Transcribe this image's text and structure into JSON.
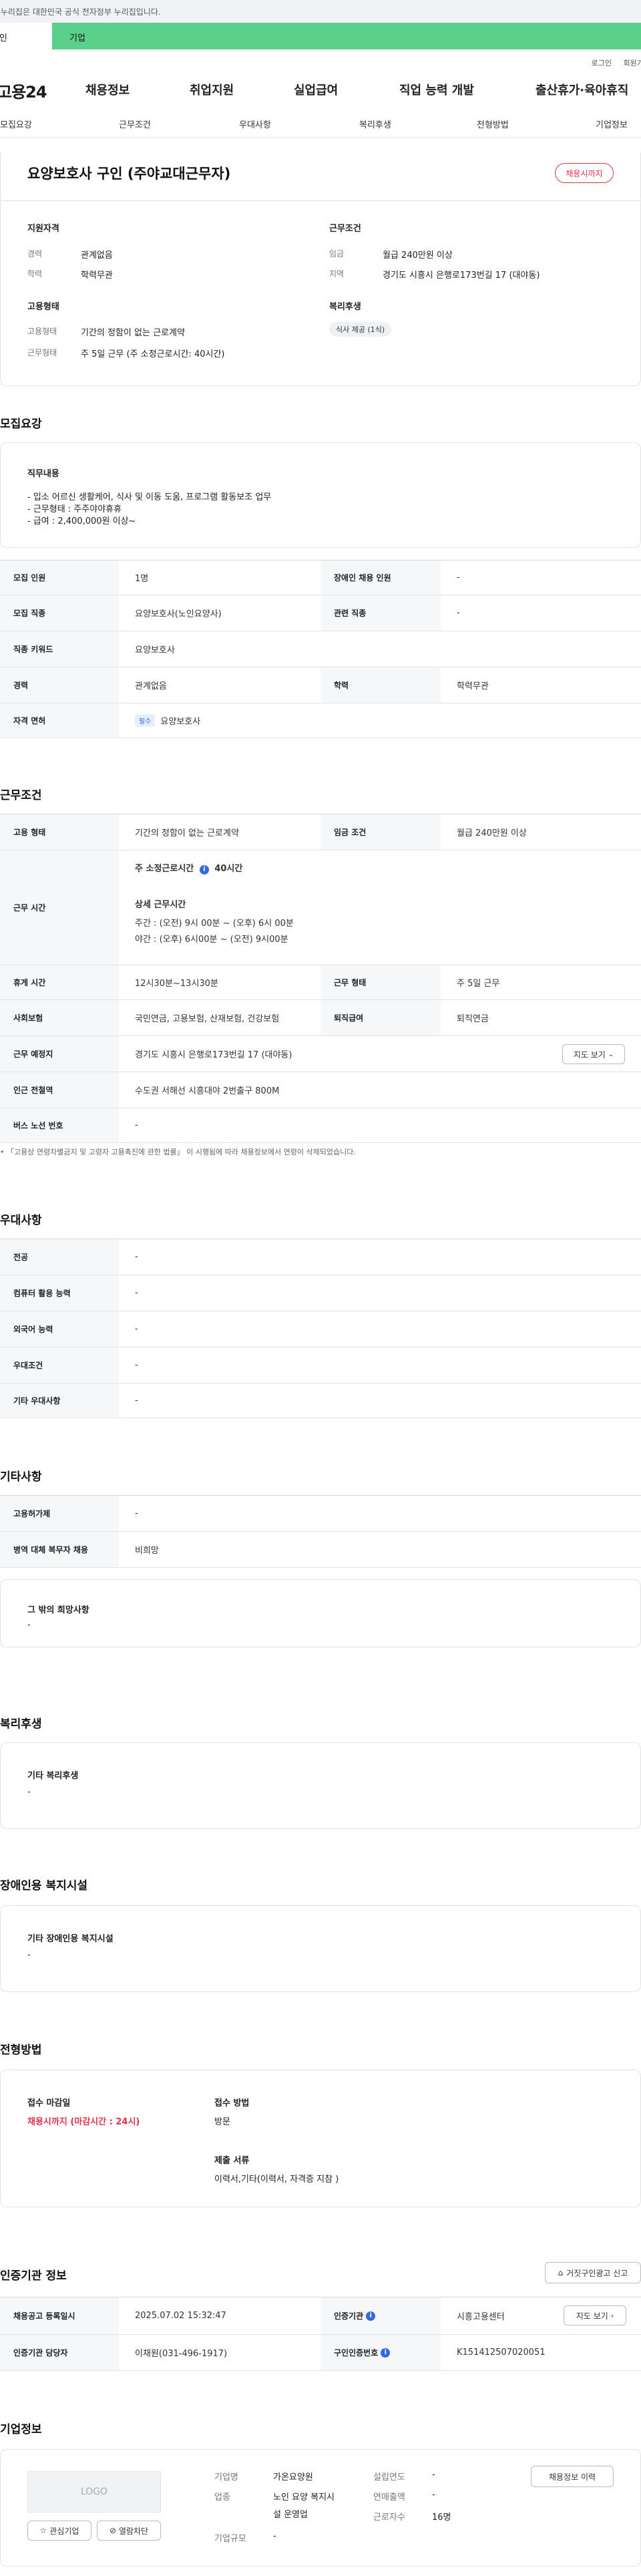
{
  "gov_bar": {
    "text": "이 누리집은 대한민국 공식 전자정부 누리집입니다."
  },
  "usertype": {
    "individual": "개인",
    "company": "기업"
  },
  "util": {
    "login": "로그인",
    "join": "회원가입"
  },
  "gnb": {
    "logo": "고용24",
    "menu": [
      "채용정보",
      "취업지원",
      "실업급여",
      "직업 능력 개발",
      "출산휴가·육아휴직"
    ]
  },
  "subnav": [
    "모집요강",
    "근무조건",
    "우대사항",
    "복리후생",
    "전형방법",
    "기업정보"
  ],
  "summary": {
    "title": "요양보호사 구인 (주야교대근무자)",
    "badge": "채용시까지",
    "qual": {
      "heading": "지원자격",
      "career_k": "경력",
      "career_v": "관계없음",
      "edu_k": "학력",
      "edu_v": "학력무관"
    },
    "emp": {
      "heading": "고용형태",
      "type_k": "고용형태",
      "type_v": "기간의 정함이 없는 근로계약",
      "days_k": "근무형태",
      "days_v": "주 5일 근무 (주 소정근로시간: 40시간)"
    },
    "cond": {
      "heading": "근무조건",
      "wage_k": "임금",
      "wage_v": "월급 240만원 이상",
      "loc_k": "지역",
      "loc_v": "경기도 시흥시 은행로173번길 17 (대야동)"
    },
    "welfare": {
      "heading": "복리후생",
      "pill": "식사 제공 (1식)"
    }
  },
  "recruit": {
    "title": "모집요강",
    "duties_heading": "직무내용",
    "duties": [
      "- 입소 어르신 생활케어, 식사 및 이동 도움, 프로그램 활동보조 업무",
      "- 근무형태 : 주주야야휴휴",
      "- 급여 : 2,400,000원 이상~"
    ],
    "rows": [
      {
        "k1": "모집 인원",
        "v1": "1명",
        "k2": "장애인 채용 인원",
        "v2": "-"
      },
      {
        "k1": "모집 직종",
        "v1": "요양보호사(노인요양사)",
        "k2": "관련 직종",
        "v2": "-"
      },
      {
        "k1": "직종 키워드",
        "v1": "요양보호사"
      },
      {
        "k1": "경력",
        "v1": "관계없음",
        "k2": "학력",
        "v2": "학력무관"
      },
      {
        "k1": "자격 면허",
        "tag": "필수",
        "v1": "요양보호사"
      }
    ]
  },
  "work": {
    "title": "근무조건",
    "type_k": "고용 형태",
    "type_v": "기간의 정함이 없는 근로계약",
    "wage_k": "임금 조건",
    "wage_v": "월급 240만원 이상",
    "hours_k": "근무 시간",
    "hours_weekly": "주 소정근로시간",
    "hours_weekly_val": "40시간",
    "hours_detail_heading": "상세 근무시간",
    "hours_day": "주간 : (오전) 9시 00분 ~ (오후) 6시 00분",
    "hours_night": "야간 : (오후) 6시00분 ~ (오전) 9시00분",
    "break_k": "휴게 시간",
    "break_v": "12시30분~13시30분",
    "form_k": "근무 형태",
    "form_v": "주 5일 근무",
    "ins_k": "사회보험",
    "ins_v": "국민연금, 고용보험, 산재보험, 건강보험",
    "ret_k": "퇴직급여",
    "ret_v": "퇴직연금",
    "addr_k": "근무 예정지",
    "addr_v": "경기도 시흥시 은행로173번길 17 (대야동)",
    "map_btn": "지도 보기",
    "subway_k": "인근 전철역",
    "subway_v": "수도권 서해선 시흥대야 2번출구 800M",
    "bus_k": "버스 노선 번호",
    "bus_v": "-",
    "note": "「고용상 연령차별금지 및 고령자 고용촉진에 관한 법률」 이 시행됨에 따라 채용정보에서 연령이 삭제되었습니다."
  },
  "pref": {
    "title": "우대사항",
    "rows": [
      {
        "k": "전공",
        "v": "-"
      },
      {
        "k": "컴퓨터 활용 능력",
        "v": "-"
      },
      {
        "k": "외국어 능력",
        "v": "-"
      },
      {
        "k": "우대조건",
        "v": "-"
      },
      {
        "k": "기타 우대사항",
        "v": "-"
      }
    ]
  },
  "etc": {
    "title": "기타사항",
    "rows": [
      {
        "k": "고용허가제",
        "v": "-"
      },
      {
        "k": "병역 대체 복무자 채용",
        "v": "비희망"
      }
    ],
    "other_heading": "그 밖의 희망사항",
    "other_v": "-"
  },
  "welfare": {
    "title": "복리후생",
    "heading": "기타 복리후생",
    "v": "-"
  },
  "disab": {
    "title": "장애인용 복지시설",
    "heading": "기타 장애인용 복지시설",
    "v": "-"
  },
  "select": {
    "title": "전형방법",
    "deadline_heading": "접수 마감일",
    "deadline_v": "채용시까지 (마감시간 : 24시)",
    "method_heading": "접수 방법",
    "method_v": "방문",
    "docs_heading": "제출 서류",
    "docs_v": "이력서,기타(이력서, 자격증 지참 )"
  },
  "cert": {
    "title": "인증기관 정보",
    "report_btn": "거짓구인광고 신고",
    "reg_k": "채용공고 등록일시",
    "reg_v": "2025.07.02 15:32:47",
    "org_k": "인증기관",
    "org_v": "시흥고용센터",
    "map_btn": "지도 보기",
    "mgr_k": "인증기관 담당자",
    "mgr_v": "이채원(031-496-1917)",
    "no_k": "구인인증번호",
    "no_v": "K151412507020051"
  },
  "company": {
    "title": "기업정보",
    "logo": "LOGO",
    "fav_btn": "관심기업",
    "block_btn": "열람차단",
    "name_k": "기업명",
    "name_v": "가온요양원",
    "biz_k": "업종",
    "biz_v1": "노인 요양 복지시",
    "biz_v2": "설 운영업",
    "size_k": "기업규모",
    "size_v": "-",
    "est_k": "설립연도",
    "est_v": "-",
    "sales_k": "연매출액",
    "sales_v": "-",
    "emp_k": "근로자수",
    "emp_v": "16명",
    "history_btn": "채용정보 이력"
  }
}
